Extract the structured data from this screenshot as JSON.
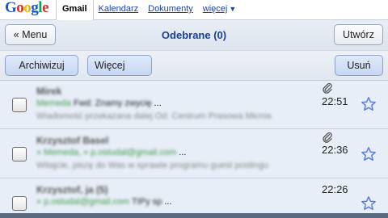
{
  "google_logo": "Google",
  "nav": {
    "active_tab": "Gmail",
    "links": [
      "Kalendarz",
      "Dokumenty",
      "więcej"
    ],
    "more_caret": "▼"
  },
  "titlebar": {
    "menu_button": "« Menu",
    "title": "Odebrane (0)",
    "compose_button": "Utwórz"
  },
  "actions": {
    "archive": "Archiwizuj",
    "more": "Więcej",
    "delete": "Usuń"
  },
  "messages": [
    {
      "sender": "Mirek",
      "label": "Memeda",
      "subject": "Fwd: Znamy zwycię",
      "ellipsis": "...",
      "snippet": "Wiadomość przekazana dalej Od: Centrum Prasowa Micros",
      "time": "22:51",
      "has_attachment": true,
      "starred": false
    },
    {
      "sender": "Krzysztof Basel",
      "label": "» Memeda, » p.ostudal@gmail.com",
      "subject": "",
      "ellipsis": "...",
      "snippet": "Witajcie, piszę do Was w sprawie programu guest postingu",
      "time": "22:36",
      "has_attachment": true,
      "starred": false
    },
    {
      "sender": "Krzysztof, ja (5)",
      "label": "» p.ostudal@gmail.com",
      "subject": "TIPy sp",
      "ellipsis": "...",
      "snippet": "",
      "time": "22:26",
      "has_attachment": false,
      "starred": false
    }
  ],
  "colors": {
    "title_blue": "#1b3d9a",
    "link_blue": "#1a3fb6",
    "row_bg": "#e8eef8",
    "label_green": "#3f9a4a"
  },
  "icons": {
    "attachment": "paperclip-icon",
    "star": "star-outline-icon",
    "checkbox": "checkbox-unchecked"
  }
}
